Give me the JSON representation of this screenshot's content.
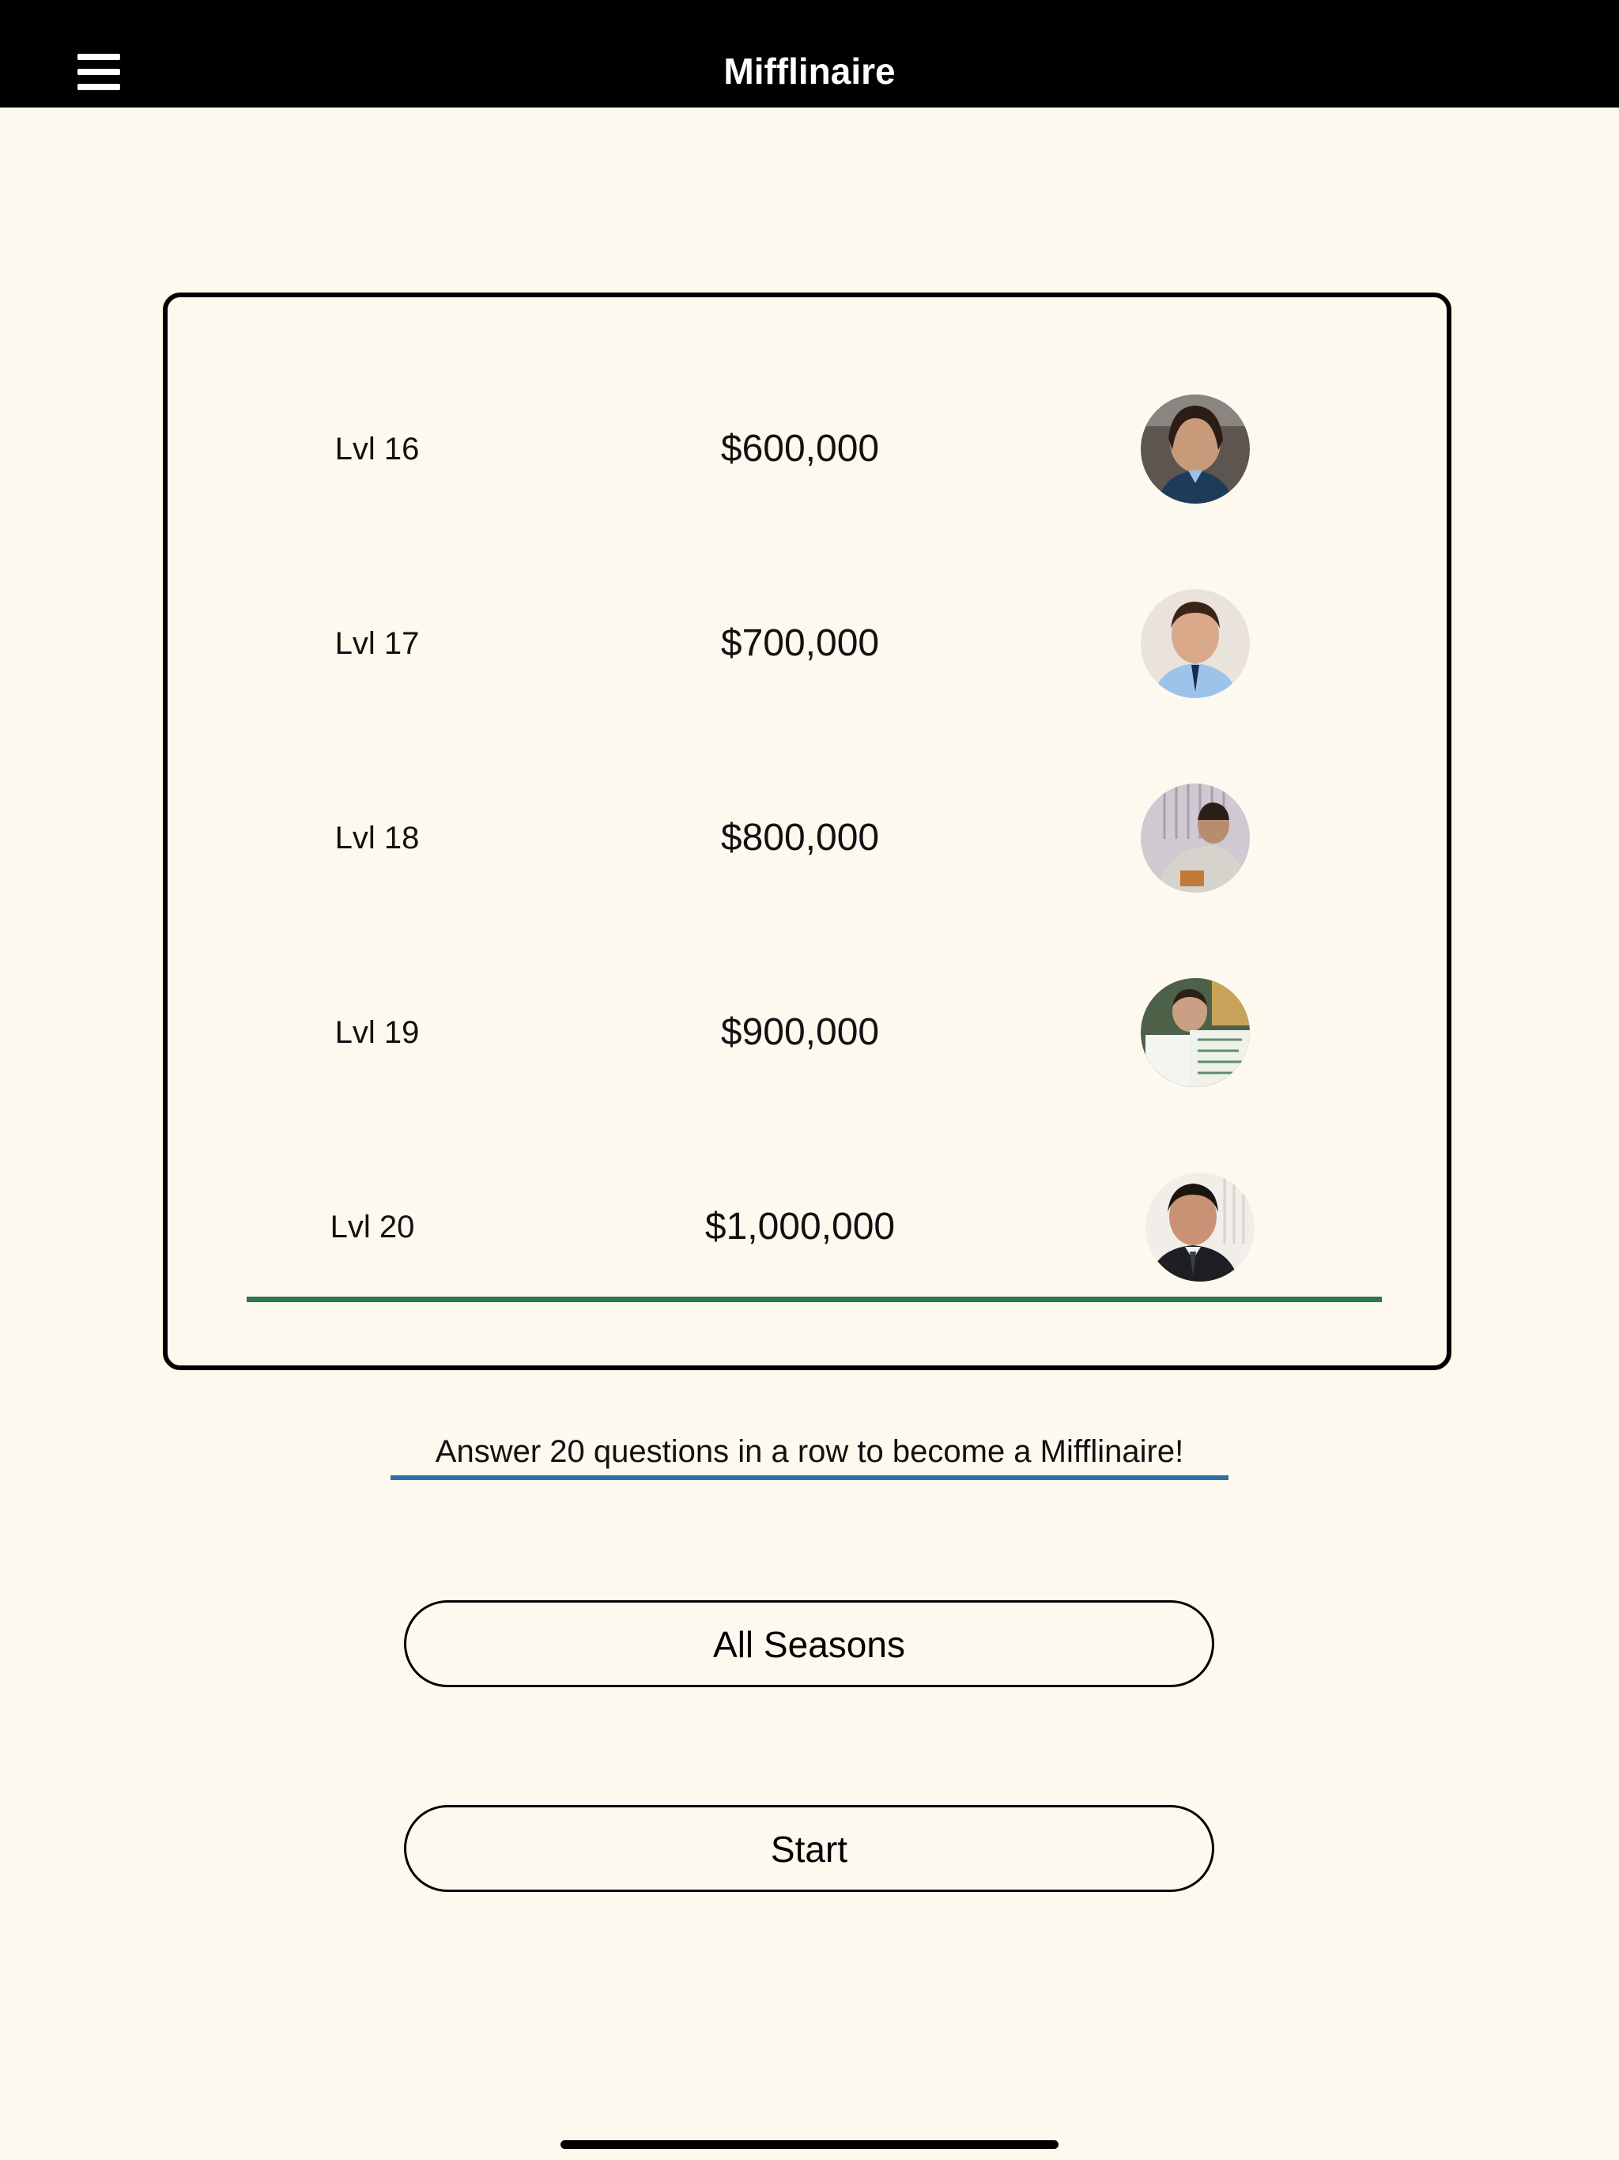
{
  "header": {
    "title": "Mifflinaire",
    "menu_icon": "hamburger-menu-icon"
  },
  "levels": [
    {
      "level": "Lvl 16",
      "amount": "$600,000",
      "avatar": "character-avatar"
    },
    {
      "level": "Lvl 17",
      "amount": "$700,000",
      "avatar": "character-avatar"
    },
    {
      "level": "Lvl 18",
      "amount": "$800,000",
      "avatar": "character-avatar"
    },
    {
      "level": "Lvl 19",
      "amount": "$900,000",
      "avatar": "character-avatar"
    },
    {
      "level": "Lvl 20",
      "amount": "$1,000,000",
      "avatar": "character-avatar"
    }
  ],
  "tagline": "Answer 20 questions in a row to become a Mifflinaire!",
  "buttons": {
    "season": "All Seasons",
    "start": "Start"
  },
  "colors": {
    "background": "#fdf9ef",
    "topbar": "#000000",
    "accent_green": "#2f7550",
    "accent_blue": "#2f6ea6"
  }
}
